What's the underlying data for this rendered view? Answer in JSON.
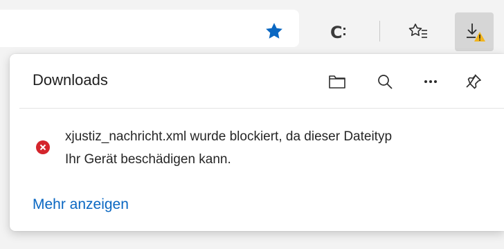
{
  "toolbar": {
    "favorite_icon": "star-filled-icon",
    "collections_icon": "c-collections-icon",
    "favorites_icon": "favorites-list-icon",
    "downloads_icon": "download-warning-icon",
    "accent_color": "#0a67c2",
    "warning_color": "#f2b51d"
  },
  "downloads_panel": {
    "title": "Downloads",
    "actions": [
      "folder-icon",
      "search-icon",
      "more-icon",
      "pin-icon"
    ],
    "item": {
      "status_icon": "error-icon",
      "status_color": "#d4252c",
      "message_line1": "xjustiz_nachricht.xml wurde blockiert, da dieser Dateityp",
      "message_line2": "Ihr Gerät beschädigen kann."
    },
    "more_link": "Mehr anzeigen"
  }
}
